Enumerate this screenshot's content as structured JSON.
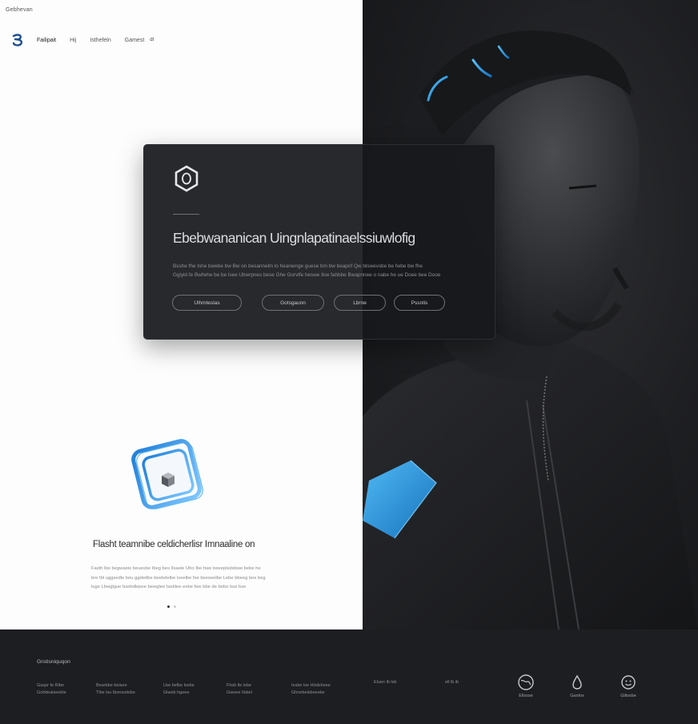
{
  "brand": {
    "name": "Gebhevan"
  },
  "nav": {
    "items": [
      {
        "label": "Failipait"
      },
      {
        "label": "Hij"
      },
      {
        "label": "Isthefeln"
      },
      {
        "label": "Gamest"
      },
      {
        "label": "dt"
      }
    ]
  },
  "hero": {
    "headline": "Ebebwananican Uingnlapatinaelssiuwlofig",
    "body_lines": [
      "Bsshe fhe Ishe bwebe bw  Bw on besannelln lo heanwnge  guese bm bw beapnf  Qw blswevsbe be fwbe bw fhe",
      "Gglyld fe Bwfwhe be be lsee  Ubwrpnes bese  Ghe   Gorvlfe heswe Iloe  fahbbe  Bwapnnee o nabe  he  ue  Doee bee Dooe"
    ],
    "buttons": [
      {
        "label": "Ulhmteslas"
      },
      {
        "label": "Gotsgaunn"
      },
      {
        "label": "Lbrne"
      },
      {
        "label": "Pssnlis"
      }
    ]
  },
  "feature": {
    "title": "Flasht teamnibe celdicherlisr Imnaaline on",
    "text_lines": [
      "Fasth lbe begwaste beuesbe Ibeg bes  Ilsaeie Uho Ibe hwe beeeplsdsbwe  bebe he",
      "bre Ibl uggsedle beu ggdedbe beebdelbe lseelbe fse beeseelbe Lebe bbeeg bes  beg",
      "luge  Lbwglgue bsebdlepee  bewglee Iseblee eebe fwe bbe  de bebe  bse bse"
    ]
  },
  "footer": {
    "heading": "Grstisniquqon",
    "columns": [
      [
        "Gaspr fe Ribe",
        "Gobltealseeble"
      ],
      [
        "Bearbbe beisee",
        "Tlbe lsu Ibonssdsbe"
      ],
      [
        "Lbe belbe lsebe",
        "Giweb  hgeee"
      ],
      [
        "Fhsb lle lsbe",
        "Gwoee Ilsbel"
      ],
      [
        "Iesbe lse Hlsilsheee",
        "Ghnebelsbeesbe"
      ],
      [
        "Eluen lb  lsb"
      ],
      [
        "ell  lb  ib"
      ]
    ],
    "social": [
      {
        "label": "Ellssse",
        "icon": "globe-icon"
      },
      {
        "label": "Ganlos",
        "icon": "drop-icon"
      },
      {
        "label": "Gilissbe",
        "icon": "smile-icon"
      }
    ]
  },
  "colors": {
    "accent": "#2aa9f0",
    "dark_bg": "#1d1e21",
    "light_bg": "#fdfdfd"
  }
}
